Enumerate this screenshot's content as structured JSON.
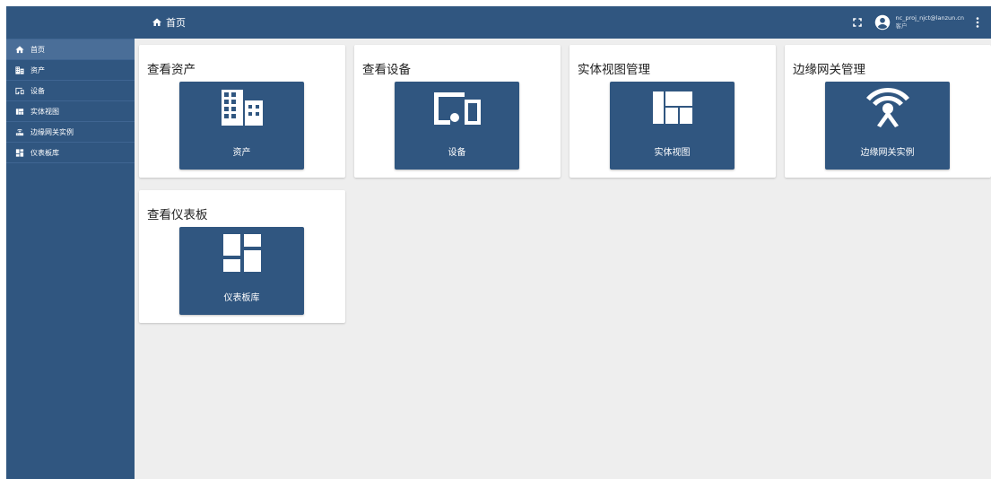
{
  "header": {
    "breadcrumb": "首页",
    "user_email": "nc_proj_njct@lanzun.cn",
    "user_role": "客户"
  },
  "sidebar": {
    "items": [
      {
        "label": "首页",
        "icon": "home-icon"
      },
      {
        "label": "资产",
        "icon": "building-icon"
      },
      {
        "label": "设备",
        "icon": "devices-icon"
      },
      {
        "label": "实体视图",
        "icon": "view-quilt-icon"
      },
      {
        "label": "边缘网关实例",
        "icon": "router-icon"
      },
      {
        "label": "仪表板库",
        "icon": "dashboard-icon"
      }
    ]
  },
  "cards": [
    {
      "title": "查看资产",
      "tile_label": "资产",
      "icon": "building-icon"
    },
    {
      "title": "查看设备",
      "tile_label": "设备",
      "icon": "devices-icon"
    },
    {
      "title": "实体视图管理",
      "tile_label": "实体视图",
      "icon": "view-quilt-icon"
    },
    {
      "title": "边缘网关管理",
      "tile_label": "边缘网关实例",
      "icon": "antenna-icon"
    },
    {
      "title": "查看仪表板",
      "tile_label": "仪表板库",
      "icon": "dashboard-icon"
    }
  ],
  "colors": {
    "primary": "#305680",
    "sidebar_active": "#4a6e98",
    "background": "#eeeeee",
    "card": "#ffffff"
  }
}
